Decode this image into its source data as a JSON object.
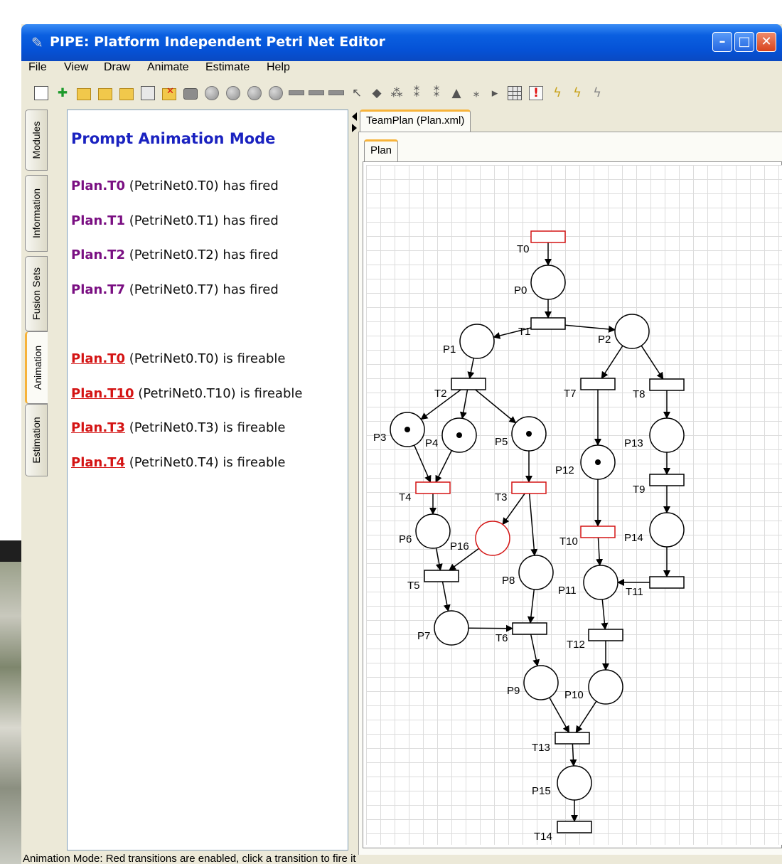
{
  "window": {
    "title": "PIPE: Platform Independent Petri Net Editor",
    "app_icon": "pipe-app-icon",
    "controls": [
      "minimize",
      "maximize",
      "close"
    ]
  },
  "menu": [
    "File",
    "View",
    "Draw",
    "Animate",
    "Estimate",
    "Help"
  ],
  "toolbar_icons": [
    "new-file-icon",
    "add-module-icon",
    "open-folder-icon",
    "folder-icon",
    "folder-icon",
    "close-file-icon",
    "delete-folder-icon",
    "print-icon",
    "place-icon",
    "place-icon",
    "place-icon",
    "place-token-icon",
    "transition-icon",
    "transition-icon",
    "transition-icon",
    "arc-icon",
    "annotation-icon",
    "add-token-icon",
    "transition-arc-icon",
    "delete-arc-icon",
    "tree-icon",
    "remove-token-icon",
    "select-icon",
    "grid-icon",
    "animation-mode-icon",
    "bolt-icon",
    "bolt-icon",
    "bolt-icon"
  ],
  "side_tabs": [
    "Modules",
    "Information",
    "Fusion Sets",
    "Animation",
    "Estimation"
  ],
  "active_side_tab": "Animation",
  "animation_panel": {
    "title": "Prompt Animation Mode",
    "fired": [
      {
        "name": "Plan.T0",
        "text": " (PetriNet0.T0) has fired"
      },
      {
        "name": "Plan.T1",
        "text": " (PetriNet0.T1) has fired"
      },
      {
        "name": "Plan.T2",
        "text": " (PetriNet0.T2) has fired"
      },
      {
        "name": "Plan.T7",
        "text": " (PetriNet0.T7) has fired"
      }
    ],
    "fireable": [
      {
        "name": "Plan.T0",
        "text": " (PetriNet0.T0) is fireable"
      },
      {
        "name": "Plan.T10",
        "text": " (PetriNet0.T10) is fireable"
      },
      {
        "name": "Plan.T3",
        "text": " (PetriNet0.T3) is fireable"
      },
      {
        "name": "Plan.T4",
        "text": " (PetriNet0.T4) is fireable"
      }
    ]
  },
  "editor": {
    "file_tab": "TeamPlan (Plan.xml)",
    "inner_tab": "Plan"
  },
  "petri_net": {
    "places": [
      {
        "id": "P0",
        "label": "P0",
        "tokens": 0
      },
      {
        "id": "P1",
        "label": "P1",
        "tokens": 0
      },
      {
        "id": "P2",
        "label": "P2",
        "tokens": 0
      },
      {
        "id": "P3",
        "label": "P3",
        "tokens": 1
      },
      {
        "id": "P4",
        "label": "P4",
        "tokens": 1
      },
      {
        "id": "P5",
        "label": "P5",
        "tokens": 1
      },
      {
        "id": "P6",
        "label": "P6",
        "tokens": 0
      },
      {
        "id": "P7",
        "label": "P7",
        "tokens": 0
      },
      {
        "id": "P8",
        "label": "P8",
        "tokens": 0
      },
      {
        "id": "P9",
        "label": "P9",
        "tokens": 0
      },
      {
        "id": "P10",
        "label": "P10",
        "tokens": 0
      },
      {
        "id": "P11",
        "label": "P11",
        "tokens": 0
      },
      {
        "id": "P12",
        "label": "P12",
        "tokens": 1
      },
      {
        "id": "P13",
        "label": "P13",
        "tokens": 0
      },
      {
        "id": "P14",
        "label": "P14",
        "tokens": 0
      },
      {
        "id": "P15",
        "label": "P15",
        "tokens": 0
      },
      {
        "id": "P16",
        "label": "P16",
        "tokens": 0,
        "highlight": true
      }
    ],
    "transitions": [
      {
        "id": "T0",
        "label": "T0",
        "enabled": true
      },
      {
        "id": "T1",
        "label": "T1",
        "enabled": false
      },
      {
        "id": "T2",
        "label": "T2",
        "enabled": false
      },
      {
        "id": "T3",
        "label": "T3",
        "enabled": true
      },
      {
        "id": "T4",
        "label": "T4",
        "enabled": true
      },
      {
        "id": "T5",
        "label": "T5",
        "enabled": false
      },
      {
        "id": "T6",
        "label": "T6",
        "enabled": false
      },
      {
        "id": "T7",
        "label": "T7",
        "enabled": false
      },
      {
        "id": "T8",
        "label": "T8",
        "enabled": false
      },
      {
        "id": "T9",
        "label": "T9",
        "enabled": false
      },
      {
        "id": "T10",
        "label": "T10",
        "enabled": true
      },
      {
        "id": "T11",
        "label": "T11",
        "enabled": false
      },
      {
        "id": "T12",
        "label": "T12",
        "enabled": false
      },
      {
        "id": "T13",
        "label": "T13",
        "enabled": false
      },
      {
        "id": "T14",
        "label": "T14",
        "enabled": false
      }
    ],
    "arcs": [
      [
        "T0",
        "P0"
      ],
      [
        "P0",
        "T1"
      ],
      [
        "T1",
        "P1"
      ],
      [
        "T1",
        "P2"
      ],
      [
        "P1",
        "T2"
      ],
      [
        "T2",
        "P3"
      ],
      [
        "T2",
        "P4"
      ],
      [
        "T2",
        "P5"
      ],
      [
        "P2",
        "T7"
      ],
      [
        "P2",
        "T8"
      ],
      [
        "P3",
        "T4"
      ],
      [
        "P4",
        "T4"
      ],
      [
        "P5",
        "T3"
      ],
      [
        "T7",
        "P12"
      ],
      [
        "T8",
        "P13"
      ],
      [
        "T4",
        "P6"
      ],
      [
        "T3",
        "P16"
      ],
      [
        "T3",
        "P8"
      ],
      [
        "P12",
        "T10"
      ],
      [
        "P13",
        "T9"
      ],
      [
        "T9",
        "P14"
      ],
      [
        "P6",
        "T5"
      ],
      [
        "P16",
        "T5"
      ],
      [
        "T10",
        "P11"
      ],
      [
        "P14",
        "T11"
      ],
      [
        "T11",
        "P11"
      ],
      [
        "T5",
        "P7"
      ],
      [
        "P7",
        "T6"
      ],
      [
        "P8",
        "T6"
      ],
      [
        "P11",
        "T12"
      ],
      [
        "T6",
        "P9"
      ],
      [
        "T12",
        "P10"
      ],
      [
        "P9",
        "T13"
      ],
      [
        "P10",
        "T13"
      ],
      [
        "T13",
        "P15"
      ],
      [
        "P15",
        "T14"
      ]
    ]
  },
  "status": "Animation Mode: Red transitions are enabled, click a transition to fire it",
  "colors": {
    "enabled": "#d41414",
    "fired_name": "#7a0f82",
    "title_blue": "#1a22c0",
    "titlebar": "#0552d6"
  }
}
